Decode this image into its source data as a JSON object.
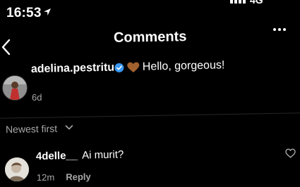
{
  "status_bar": {
    "time": "16:53",
    "network": "4G"
  },
  "header": {
    "title": "Comments"
  },
  "caption": {
    "username": "adelina.pestritu",
    "text": "Hello, gorgeous!",
    "time": "6d"
  },
  "sort": {
    "label": "Newest first"
  },
  "comments": [
    {
      "username": "4delle__",
      "text": "Ai murit?",
      "time": "12m",
      "reply_label": "Reply"
    }
  ],
  "icons": {
    "back": "chevron-left-icon",
    "more": "more-horizontal-icon",
    "verified": "verified-badge-icon",
    "heart_emoji": "brown-heart-icon",
    "like": "heart-outline-icon",
    "sort_chevron": "chevron-down-icon"
  },
  "colors": {
    "background": "#000000",
    "text": "#ffffff",
    "muted": "#a8a8a8",
    "verified": "#3897f0",
    "heart": "#a0612f"
  }
}
